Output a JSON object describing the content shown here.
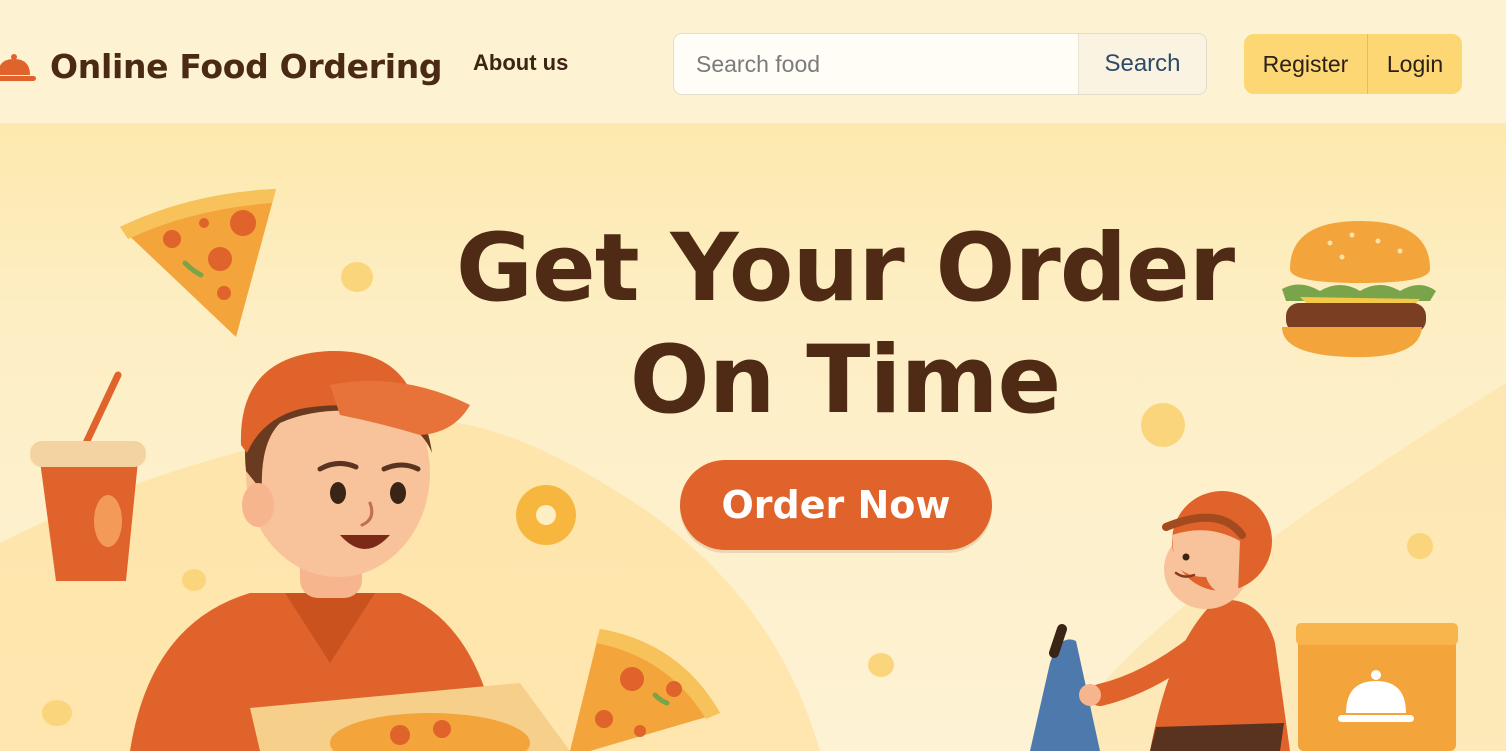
{
  "brand": {
    "name": "Online Food Ordering",
    "icon": "cloche-icon"
  },
  "nav": {
    "about_label": "About us"
  },
  "search": {
    "placeholder": "Search food",
    "value": "",
    "button_label": "Search"
  },
  "auth": {
    "register_label": "Register",
    "login_label": "Login"
  },
  "hero": {
    "title_line1": "Get Your Order",
    "title_line2": "On Time",
    "cta_label": "Order Now"
  },
  "colors": {
    "accent": "#e0632b",
    "brand_text": "#4a2a15",
    "auth_bg": "#fcd773",
    "header_bg": "#fdf2d2",
    "hero_bg": "#fdecb8"
  }
}
